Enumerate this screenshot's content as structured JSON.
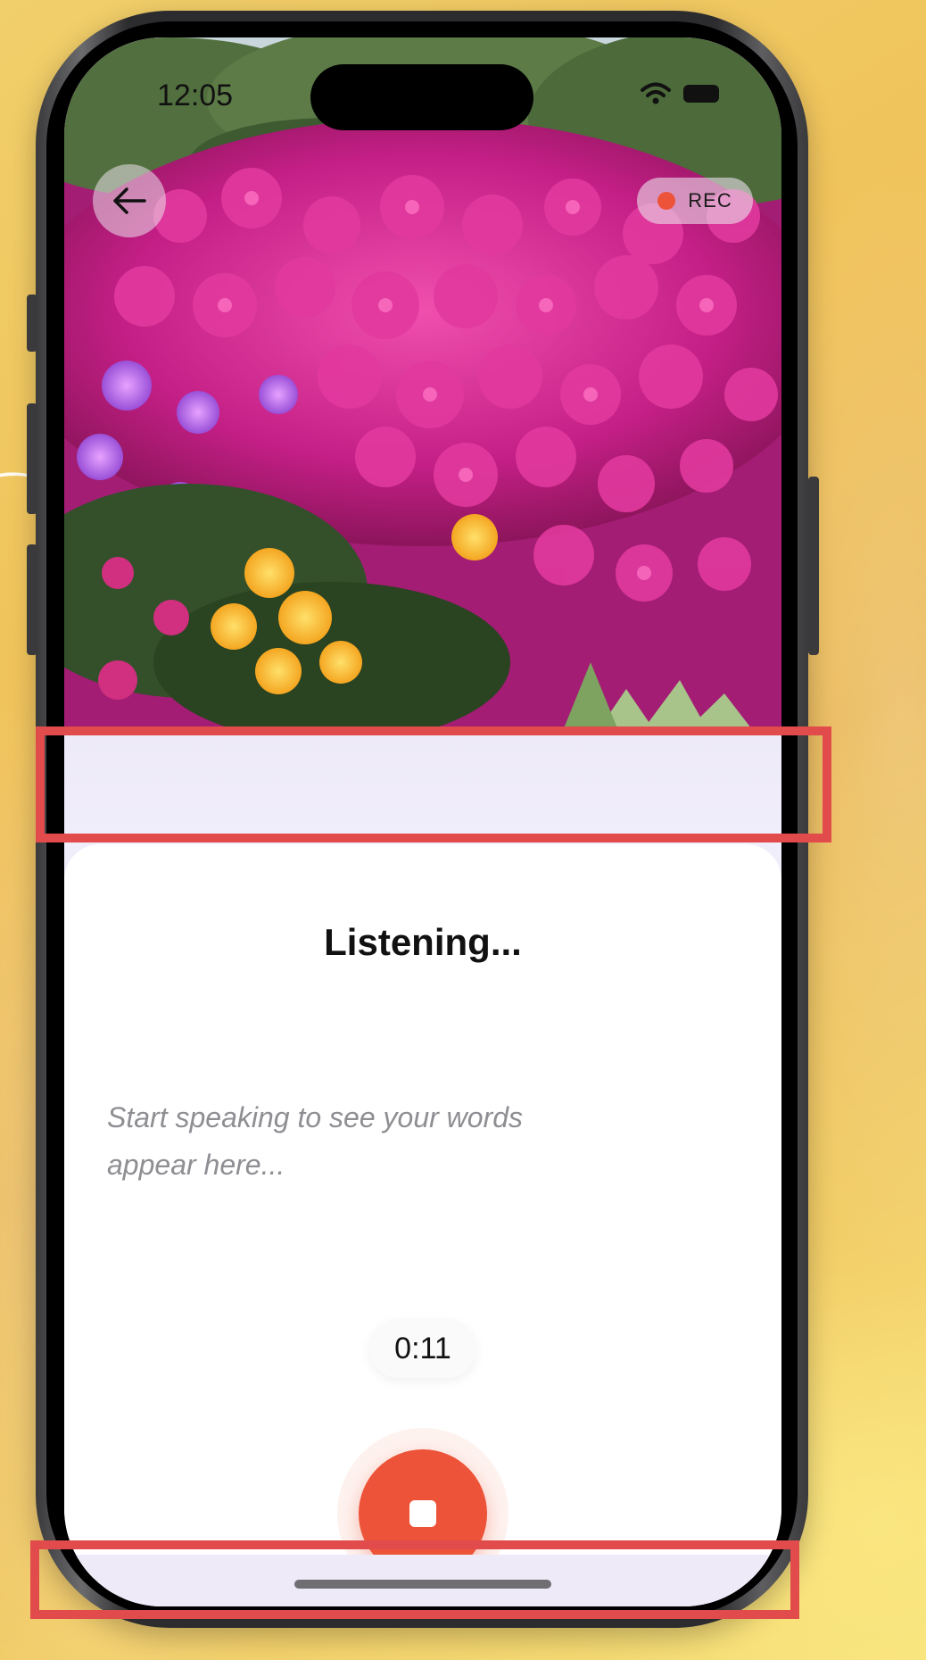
{
  "status_bar": {
    "time": "12:05",
    "wifi_icon": "wifi-icon",
    "battery_icon": "battery-icon"
  },
  "top_bar": {
    "back_icon": "arrow-left-icon",
    "rec_label": "REC",
    "rec_dot_color": "#ec5338"
  },
  "sheet": {
    "title": "Listening...",
    "placeholder": "Start speaking to see your words appear here...",
    "timer": "0:11",
    "stop_icon": "stop-icon",
    "accent": "#ec5338"
  },
  "annotation_color": "#e24b4b"
}
